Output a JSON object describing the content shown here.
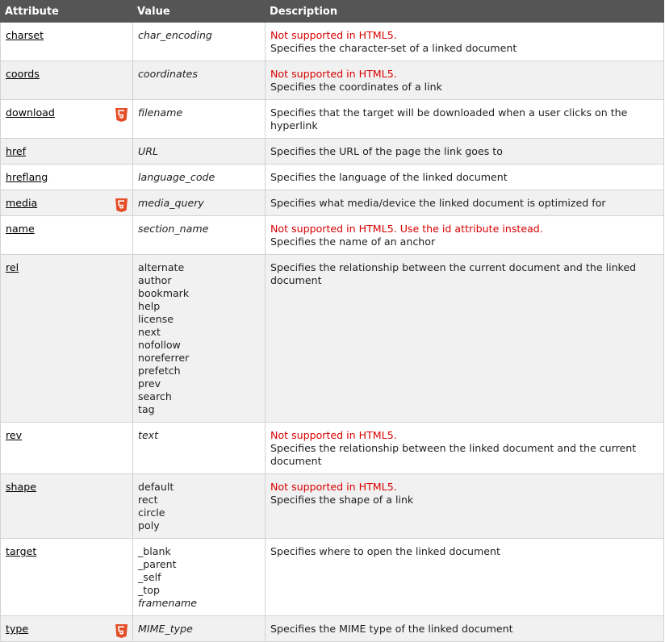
{
  "headers": {
    "attribute": "Attribute",
    "value": "Value",
    "description": "Description"
  },
  "rows": [
    {
      "attr": "charset",
      "html5": false,
      "values": [
        {
          "text": "char_encoding",
          "italic": true
        }
      ],
      "note": "Not supported in HTML5.",
      "desc": "Specifies the character-set of a linked document"
    },
    {
      "attr": "coords",
      "html5": false,
      "values": [
        {
          "text": "coordinates",
          "italic": true
        }
      ],
      "note": "Not supported in HTML5.",
      "desc": "Specifies the coordinates of a link"
    },
    {
      "attr": "download",
      "html5": true,
      "values": [
        {
          "text": "filename",
          "italic": true
        }
      ],
      "note": "",
      "desc": "Specifies that the target will be downloaded when a user clicks on the hyperlink"
    },
    {
      "attr": "href",
      "html5": false,
      "values": [
        {
          "text": "URL",
          "italic": true
        }
      ],
      "note": "",
      "desc": "Specifies the URL of the page the link goes to"
    },
    {
      "attr": "hreflang",
      "html5": false,
      "values": [
        {
          "text": "language_code",
          "italic": true
        }
      ],
      "note": "",
      "desc": "Specifies the language of the linked document"
    },
    {
      "attr": "media",
      "html5": true,
      "values": [
        {
          "text": "media_query",
          "italic": true
        }
      ],
      "note": "",
      "desc": "Specifies what media/device the linked document is optimized for"
    },
    {
      "attr": "name",
      "html5": false,
      "values": [
        {
          "text": "section_name",
          "italic": true
        }
      ],
      "note": "Not supported in HTML5. Use the id attribute instead.",
      "desc": "Specifies the name of an anchor"
    },
    {
      "attr": "rel",
      "html5": false,
      "values": [
        {
          "text": "alternate",
          "italic": false
        },
        {
          "text": "author",
          "italic": false
        },
        {
          "text": "bookmark",
          "italic": false
        },
        {
          "text": "help",
          "italic": false
        },
        {
          "text": "license",
          "italic": false
        },
        {
          "text": "next",
          "italic": false
        },
        {
          "text": "nofollow",
          "italic": false
        },
        {
          "text": "noreferrer",
          "italic": false
        },
        {
          "text": "prefetch",
          "italic": false
        },
        {
          "text": "prev",
          "italic": false
        },
        {
          "text": "search",
          "italic": false
        },
        {
          "text": "tag",
          "italic": false
        }
      ],
      "note": "",
      "desc": "Specifies the relationship between the current document and the linked document"
    },
    {
      "attr": "rev",
      "html5": false,
      "values": [
        {
          "text": "text",
          "italic": true
        }
      ],
      "note": "Not supported in HTML5.",
      "desc": "Specifies the relationship between the linked document and the current document"
    },
    {
      "attr": "shape",
      "html5": false,
      "values": [
        {
          "text": "default",
          "italic": false
        },
        {
          "text": "rect",
          "italic": false
        },
        {
          "text": "circle",
          "italic": false
        },
        {
          "text": "poly",
          "italic": false
        }
      ],
      "note": "Not supported in HTML5.",
      "desc": "Specifies the shape of a link"
    },
    {
      "attr": "target",
      "html5": false,
      "values": [
        {
          "text": "_blank",
          "italic": false
        },
        {
          "text": "_parent",
          "italic": false
        },
        {
          "text": "_self",
          "italic": false
        },
        {
          "text": "_top",
          "italic": false
        },
        {
          "text": "framename",
          "italic": true
        }
      ],
      "note": "",
      "desc": "Specifies where to open the linked document"
    },
    {
      "attr": "type",
      "html5": true,
      "values": [
        {
          "text": "MIME_type",
          "italic": true
        }
      ],
      "note": "",
      "desc": "Specifies the MIME type of the linked document"
    }
  ],
  "colors": {
    "header_bg": "#555555",
    "note_red": "#d80000",
    "html5_badge": "#e44d26"
  },
  "icons": {
    "html5": "html5-icon"
  }
}
